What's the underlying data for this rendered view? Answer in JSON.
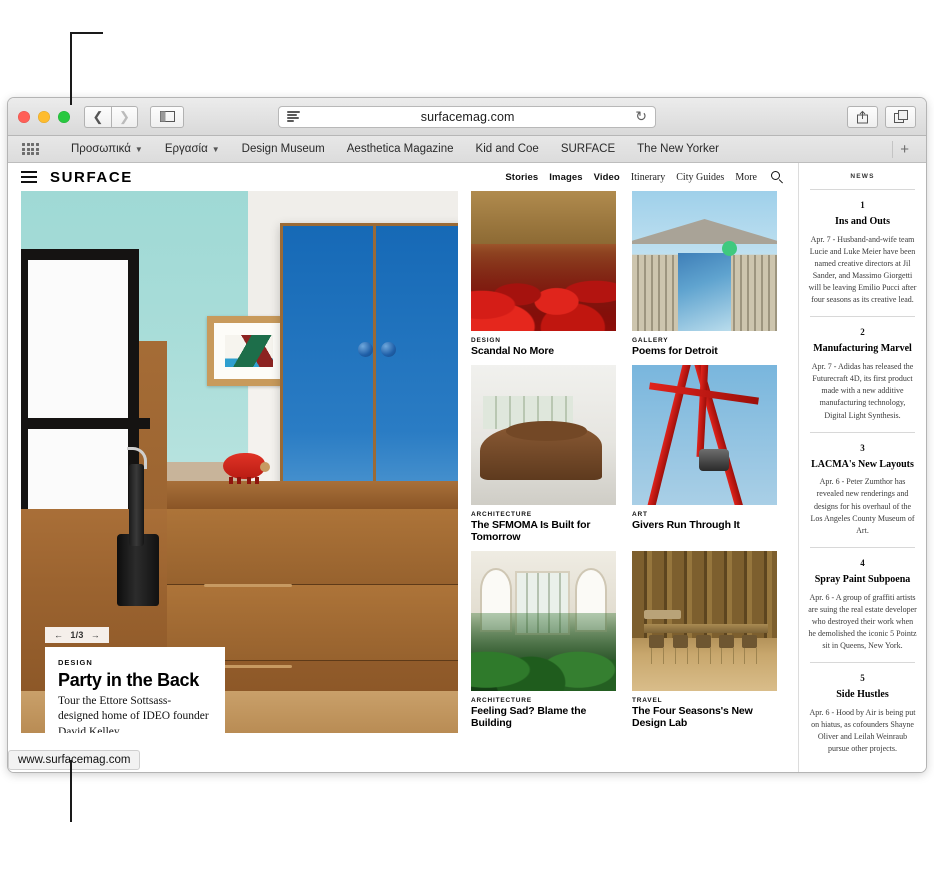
{
  "browser": {
    "url": "surfacemag.com",
    "status_url": "www.surfacemag.com",
    "back_icon": "chevron-left-icon",
    "forward_icon": "chevron-right-icon",
    "sidebar_icon": "sidebar-icon",
    "reader_icon": "reader-view-icon",
    "reload_icon": "reload-icon",
    "share_icon": "share-icon",
    "tabs_icon": "show-all-tabs-icon",
    "apps_icon": "apps-grid-icon",
    "add_bookmark_icon": "plus-icon",
    "bookmarks": [
      {
        "label": "Προσωπικά",
        "has_chevron": true
      },
      {
        "label": "Εργασία",
        "has_chevron": true
      },
      {
        "label": "Design Museum",
        "has_chevron": false
      },
      {
        "label": "Aesthetica Magazine",
        "has_chevron": false
      },
      {
        "label": "Kid and Coe",
        "has_chevron": false
      },
      {
        "label": "SURFACE",
        "has_chevron": false
      },
      {
        "label": "The New Yorker",
        "has_chevron": false
      }
    ]
  },
  "site": {
    "brand": "SURFACE",
    "menu_icon": "hamburger-menu-icon",
    "search_icon": "search-icon",
    "nav_bold": [
      "Stories",
      "Images",
      "Video"
    ],
    "nav_serif": [
      "Itinerary",
      "City Guides",
      "More"
    ]
  },
  "hero": {
    "pager_prev": "←",
    "pager_count": "1/3",
    "pager_next": "→",
    "kicker": "DESIGN",
    "title": "Party in the Back",
    "description": "Tour the Ettore Sottsass-designed home of IDEO founder David Kelley."
  },
  "cards": [
    {
      "kicker": "DESIGN",
      "title": "Scandal No More",
      "art": "t-seats"
    },
    {
      "kicker": "GALLERY",
      "title": "Poems for Detroit",
      "art": "t-gazebo"
    },
    {
      "kicker": "ARCHITECTURE",
      "title": "The SFMOMA Is Built for Tomorrow",
      "art": "t-serra"
    },
    {
      "kicker": "ART",
      "title": "Givers Run Through It",
      "art": "t-red"
    },
    {
      "kicker": "ARCHITECTURE",
      "title": "Feeling Sad? Blame the Building",
      "art": "t-plants"
    },
    {
      "kicker": "TRAVEL",
      "title": "The Four Seasons's New Design Lab",
      "art": "t-bar"
    }
  ],
  "news": {
    "heading": "NEWS",
    "items": [
      {
        "number": "1",
        "title": "Ins and Outs",
        "body": "Apr. 7 - Husband-and-wife team Lucie and Luke Meier have been named creative directors at Jil Sander, and Massimo Giorgetti will be leaving Emilio Pucci after four seasons as its creative lead."
      },
      {
        "number": "2",
        "title": "Manufacturing Marvel",
        "body": "Apr. 7 - Adidas has released the Futurecraft 4D, its first product made with a new additive manufacturing technology, Digital Light Synthesis."
      },
      {
        "number": "3",
        "title": "LACMA's New Layouts",
        "body": "Apr. 6 - Peter Zumthor has revealed new renderings and designs for his overhaul of the Los Angeles County Museum of Art."
      },
      {
        "number": "4",
        "title": "Spray Paint Subpoena",
        "body": "Apr. 6 - A group of graffiti artists are suing the real estate developer who destroyed their work when he demolished the iconic 5 Pointz sit in Queens, New York."
      },
      {
        "number": "5",
        "title": "Side Hustles",
        "body": "Apr. 6 - Hood by Air is being put on hiatus, as cofounders Shayne Oliver and Leilah Weinraub pursue other projects."
      }
    ]
  }
}
